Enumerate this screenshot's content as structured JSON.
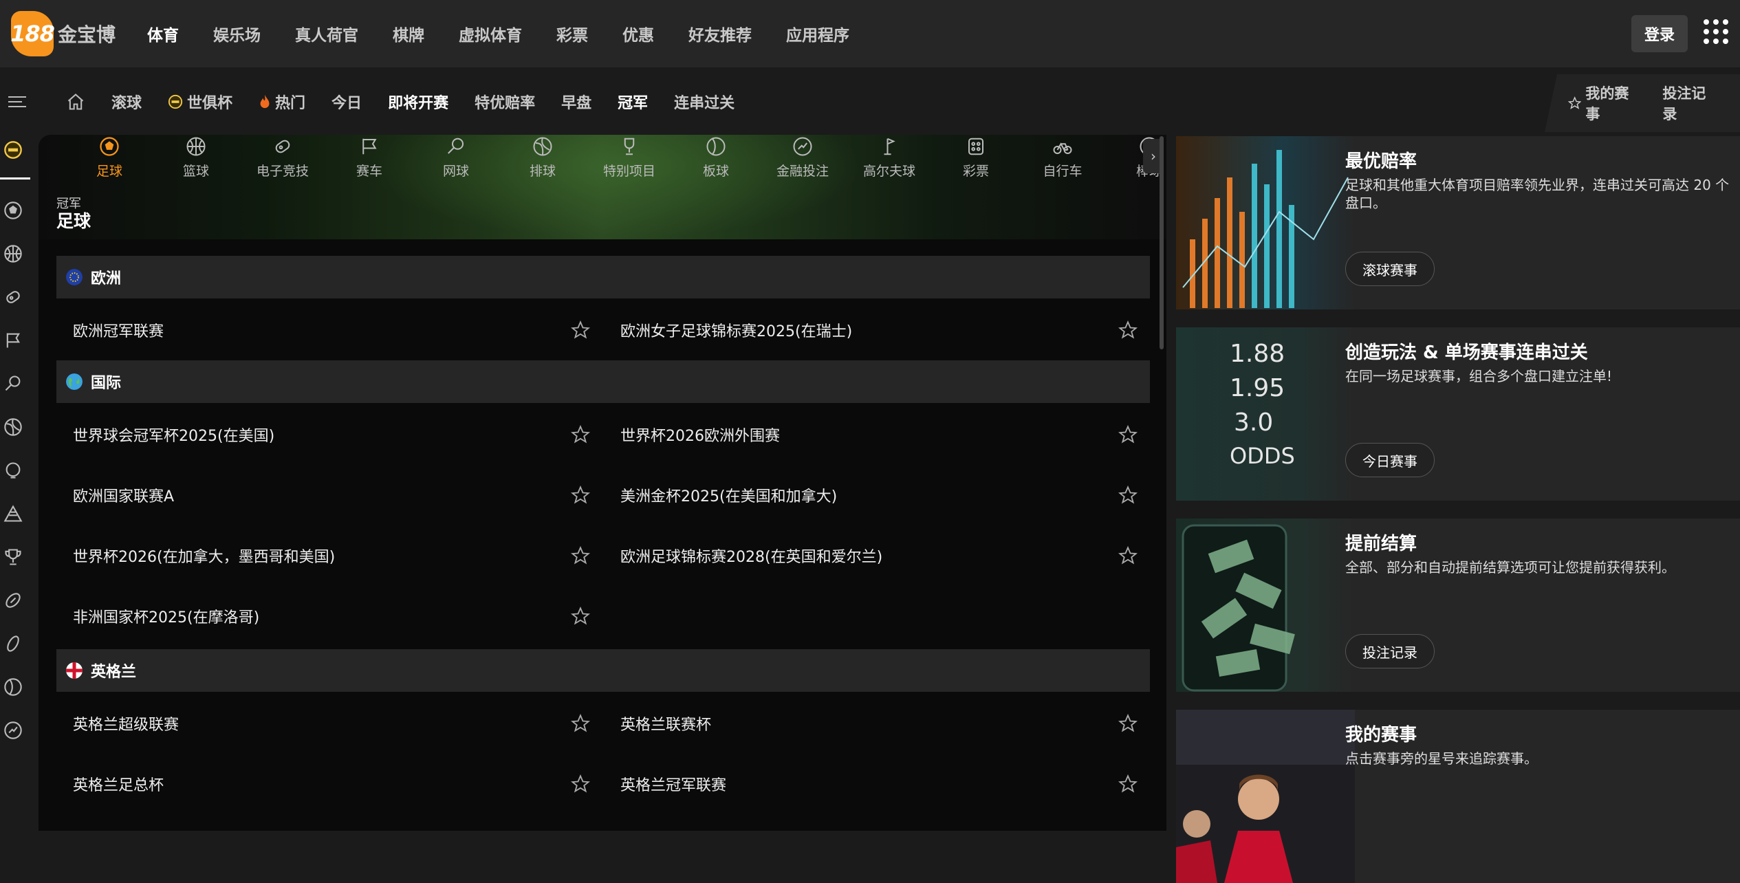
{
  "logo": {
    "badge": "188",
    "text": "金宝博"
  },
  "topnav": [
    "体育",
    "娱乐场",
    "真人荷官",
    "棋牌",
    "虚拟体育",
    "彩票",
    "优惠",
    "好友推荐",
    "应用程序"
  ],
  "login_label": "登录",
  "subnav": {
    "items": [
      "滚球",
      "世俱杯",
      "热门",
      "今日",
      "即将开赛",
      "特优赔率",
      "早盘",
      "冠军",
      "连串过关"
    ],
    "right": [
      "我的赛事",
      "投注记录"
    ]
  },
  "sports": [
    "足球",
    "篮球",
    "电子竞技",
    "赛车",
    "网球",
    "排球",
    "特别项目",
    "板球",
    "金融投注",
    "高尔夫球",
    "彩票",
    "自行车",
    "棒球"
  ],
  "hero": {
    "caption": "冠军",
    "title": "足球"
  },
  "regions": [
    {
      "name": "欧洲",
      "competitions": [
        "欧洲冠军联赛",
        "欧洲女子足球锦标赛2025(在瑞士)"
      ]
    },
    {
      "name": "国际",
      "competitions": [
        "世界球会冠军杯2025(在美国)",
        "世界杯2026欧洲外围赛",
        "欧洲国家联赛A",
        "美洲金杯2025(在美国和加拿大)",
        "世界杯2026(在加拿大，墨西哥和美国)",
        "欧洲足球锦标赛2028(在英国和爱尔兰)",
        "非洲国家杯2025(在摩洛哥)"
      ]
    },
    {
      "name": "英格兰",
      "competitions": [
        "英格兰超级联赛",
        "英格兰联赛杯",
        "英格兰足总杯",
        "英格兰冠军联赛"
      ]
    }
  ],
  "promos": [
    {
      "title": "最优赔率",
      "desc": "足球和其他重大体育项目赔率领先业界，连串过关可高达 20 个盘口。",
      "button": "滚球赛事"
    },
    {
      "title": "创造玩法 & 单场赛事连串过关",
      "desc": "在同一场足球赛事，组合多个盘口建立注单!",
      "button": "今日赛事",
      "image_text": [
        "1.88",
        "1.95",
        "3.0",
        "ODDS"
      ]
    },
    {
      "title": "提前结算",
      "desc": "全部、部分和自动提前结算选项可让您提前获得获利。",
      "button": "投注记录"
    },
    {
      "title": "我的赛事",
      "desc": "点击赛事旁的星号来追踪赛事。"
    }
  ],
  "colors": {
    "accent": "#f7941d",
    "bg": "#0a0a0a",
    "panel": "#262626"
  }
}
